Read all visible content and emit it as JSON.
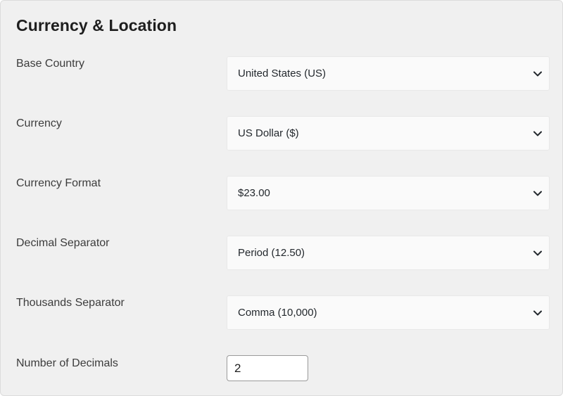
{
  "section": {
    "title": "Currency & Location"
  },
  "fields": [
    {
      "label": "Base Country",
      "value": "United States (US)"
    },
    {
      "label": "Currency",
      "value": "US Dollar ($)"
    },
    {
      "label": "Currency Format",
      "value": "$23.00"
    },
    {
      "label": "Decimal Separator",
      "value": "Period (12.50)"
    },
    {
      "label": "Thousands Separator",
      "value": "Comma (10,000)"
    }
  ],
  "decimals": {
    "label": "Number of Decimals",
    "value": "2"
  },
  "icons": {
    "dropdown": "chevron-down-icon"
  }
}
